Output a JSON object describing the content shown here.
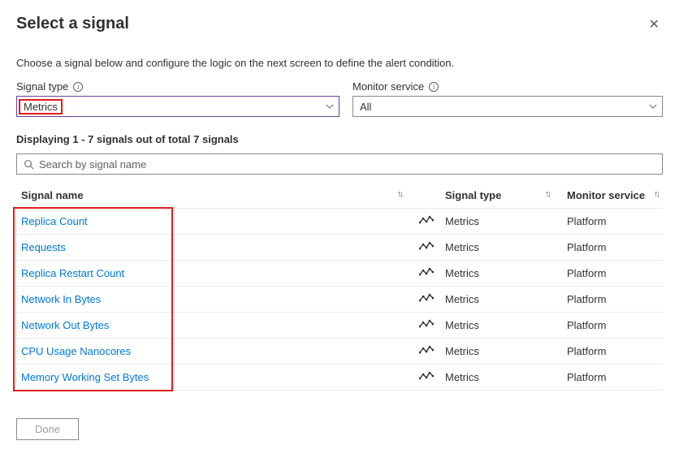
{
  "header": {
    "title": "Select a signal"
  },
  "subtitle": "Choose a signal below and configure the logic on the next screen to define the alert condition.",
  "signalType": {
    "label": "Signal type",
    "value": "Metrics"
  },
  "monitorService": {
    "label": "Monitor service",
    "value": "All"
  },
  "countLine": "Displaying 1 - 7 signals out of total 7 signals",
  "search": {
    "placeholder": "Search by signal name"
  },
  "columns": {
    "name": "Signal name",
    "type": "Signal type",
    "service": "Monitor service"
  },
  "rows": [
    {
      "name": "Replica Count",
      "type": "Metrics",
      "service": "Platform"
    },
    {
      "name": "Requests",
      "type": "Metrics",
      "service": "Platform"
    },
    {
      "name": "Replica Restart Count",
      "type": "Metrics",
      "service": "Platform"
    },
    {
      "name": "Network In Bytes",
      "type": "Metrics",
      "service": "Platform"
    },
    {
      "name": "Network Out Bytes",
      "type": "Metrics",
      "service": "Platform"
    },
    {
      "name": "CPU Usage Nanocores",
      "type": "Metrics",
      "service": "Platform"
    },
    {
      "name": "Memory Working Set Bytes",
      "type": "Metrics",
      "service": "Platform"
    }
  ],
  "doneLabel": "Done"
}
